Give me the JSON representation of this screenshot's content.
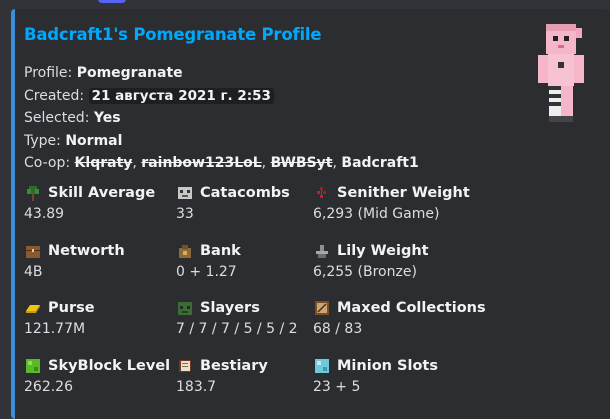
{
  "title": "Badcraft1's Pomegranate Profile",
  "description": {
    "profile_label": "Profile:",
    "profile_value": "Pomegranate",
    "created_label": "Created:",
    "created_value": "21 августа 2021 г. 2:53",
    "selected_label": "Selected:",
    "selected_value": "Yes",
    "type_label": "Type:",
    "type_value": "Normal",
    "coop_label": "Co-op:",
    "coop_members": [
      "Klqraty",
      "rainbow123LoL",
      "BWBSyt",
      "Badcraft1"
    ]
  },
  "fields": [
    {
      "name": "Skill Average",
      "value": "43.89",
      "icon": "sapling-icon"
    },
    {
      "name": "Catacombs",
      "value": "33",
      "icon": "skull-icon"
    },
    {
      "name": "Senither Weight",
      "value": "6,293 (Mid Game)",
      "icon": "red-berry-icon"
    },
    {
      "name": "Networth",
      "value": "4B",
      "icon": "chest-icon"
    },
    {
      "name": "Bank",
      "value": "0 + 1.27",
      "icon": "coin-bag-icon"
    },
    {
      "name": "Lily Weight",
      "value": "6,255 (Bronze)",
      "icon": "anvil-icon"
    },
    {
      "name": "Purse",
      "value": "121.77M",
      "icon": "gold-ingot-icon"
    },
    {
      "name": "Slayers",
      "value": "7 / 7 / 7 / 5 / 5 / 2",
      "icon": "zombie-head-icon"
    },
    {
      "name": "Maxed Collections",
      "value": "68 / 83",
      "icon": "painting-icon"
    },
    {
      "name": "SkyBlock Level",
      "value": "262.26",
      "icon": "emerald-block-icon"
    },
    {
      "name": "Bestiary",
      "value": "183.7",
      "icon": "book-icon"
    },
    {
      "name": "Minion Slots",
      "value": "23 + 5",
      "icon": "diamond-block-icon"
    }
  ],
  "colors": {
    "background": "#313338",
    "embed_background": "#2b2d31",
    "embed_accent": "#3b8fd8",
    "title": "#00a8fc"
  }
}
